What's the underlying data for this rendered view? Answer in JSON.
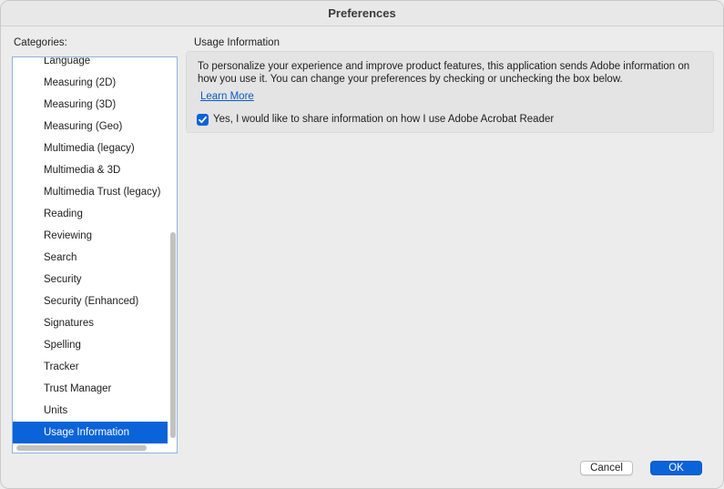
{
  "window": {
    "title": "Preferences"
  },
  "categories": {
    "label": "Categories:",
    "items": [
      "Language",
      "Measuring (2D)",
      "Measuring (3D)",
      "Measuring (Geo)",
      "Multimedia (legacy)",
      "Multimedia & 3D",
      "Multimedia Trust (legacy)",
      "Reading",
      "Reviewing",
      "Search",
      "Security",
      "Security (Enhanced)",
      "Signatures",
      "Spelling",
      "Tracker",
      "Trust Manager",
      "Units",
      "Usage Information"
    ],
    "selected_index": 17
  },
  "usage": {
    "title": "Usage Information",
    "description": "To personalize your experience and improve product features, this application sends Adobe information on how you use it. You can change your preferences by checking or unchecking the box below.",
    "learn_more": "Learn More",
    "share_checkbox_label": "Yes, I would like to share information on how I use Adobe Acrobat Reader",
    "share_checked": true
  },
  "buttons": {
    "cancel": "Cancel",
    "ok": "OK"
  },
  "colors": {
    "accent": "#0a63d8",
    "link": "#0a5bc4"
  }
}
